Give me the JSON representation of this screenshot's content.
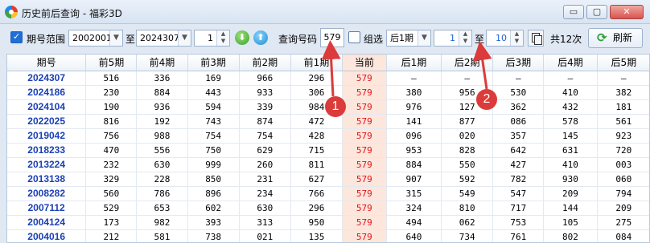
{
  "window": {
    "title": "历史前后查询 - 福彩3D",
    "minimize": "▭",
    "maximize": "▢",
    "close": "✕"
  },
  "toolbar": {
    "period_range_label": "期号范围",
    "from_value": "2002001",
    "to_label": "至",
    "to_value": "2024307",
    "count_value": "1",
    "query_label": "查询号码",
    "query_value": "579",
    "group_label": "组选",
    "after_select": "后1期",
    "after_from": "1",
    "after_to_label": "至",
    "after_to": "10",
    "total_text": "共12次",
    "refresh_label": "刷新"
  },
  "table": {
    "headers": [
      "期号",
      "前5期",
      "前4期",
      "前3期",
      "前2期",
      "前1期",
      "当前",
      "后1期",
      "后2期",
      "后3期",
      "后4期",
      "后5期"
    ],
    "rows": [
      [
        "2024307",
        "516",
        "336",
        "169",
        "966",
        "296",
        "579",
        "–",
        "–",
        "–",
        "–",
        "–"
      ],
      [
        "2024186",
        "230",
        "884",
        "443",
        "933",
        "306",
        "579",
        "380",
        "956",
        "530",
        "410",
        "382"
      ],
      [
        "2024104",
        "190",
        "936",
        "594",
        "339",
        "984",
        "579",
        "976",
        "127",
        "362",
        "432",
        "181"
      ],
      [
        "2022025",
        "816",
        "192",
        "743",
        "874",
        "472",
        "579",
        "141",
        "877",
        "086",
        "578",
        "561"
      ],
      [
        "2019042",
        "756",
        "988",
        "754",
        "754",
        "428",
        "579",
        "096",
        "020",
        "357",
        "145",
        "923"
      ],
      [
        "2018233",
        "470",
        "556",
        "750",
        "629",
        "715",
        "579",
        "953",
        "828",
        "642",
        "631",
        "720"
      ],
      [
        "2013224",
        "232",
        "630",
        "999",
        "260",
        "811",
        "579",
        "884",
        "550",
        "427",
        "410",
        "003"
      ],
      [
        "2013138",
        "329",
        "228",
        "850",
        "231",
        "627",
        "579",
        "907",
        "592",
        "782",
        "930",
        "060"
      ],
      [
        "2008282",
        "560",
        "786",
        "896",
        "234",
        "766",
        "579",
        "315",
        "549",
        "547",
        "209",
        "794"
      ],
      [
        "2007112",
        "529",
        "653",
        "602",
        "630",
        "296",
        "579",
        "324",
        "810",
        "717",
        "144",
        "209"
      ],
      [
        "2004124",
        "173",
        "982",
        "393",
        "313",
        "950",
        "579",
        "494",
        "062",
        "753",
        "105",
        "275"
      ],
      [
        "2004016",
        "212",
        "581",
        "738",
        "021",
        "135",
        "579",
        "640",
        "734",
        "761",
        "802",
        "084"
      ]
    ]
  },
  "annotations": [
    {
      "label": "1"
    },
    {
      "label": "2"
    }
  ],
  "colors": {
    "current_column_bg": "#fde6dc",
    "current_value": "#e0141b",
    "period_link": "#1a3fb5",
    "annotation": "#dc3b3b"
  }
}
